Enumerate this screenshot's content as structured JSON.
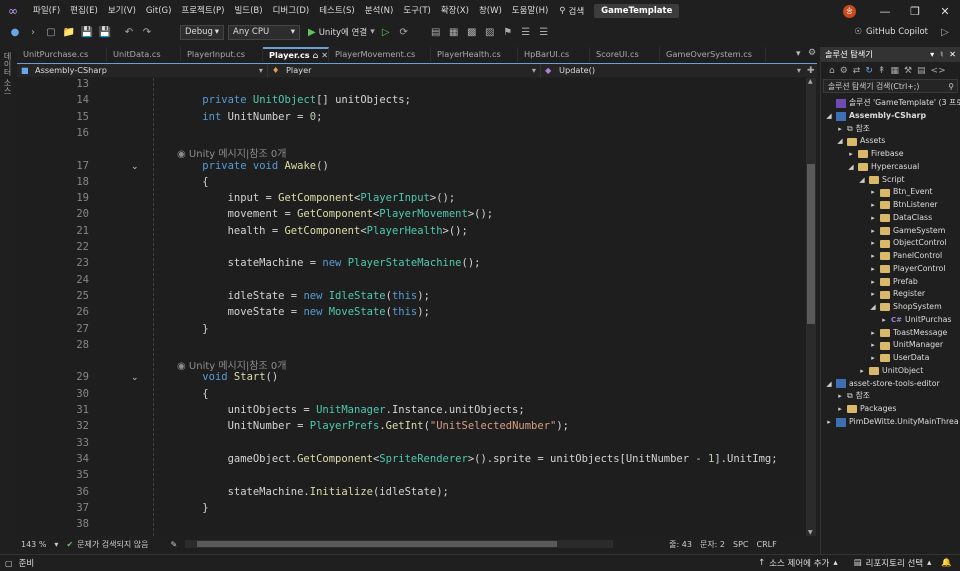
{
  "titlebar": {
    "menus": [
      "파일(F)",
      "편집(E)",
      "보기(V)",
      "Git(G)",
      "프로젝트(P)",
      "빌드(B)",
      "디버그(D)",
      "테스트(S)",
      "분석(N)",
      "도구(T)",
      "확장(X)",
      "창(W)",
      "도움말(H)"
    ],
    "search_label": "검색",
    "project_title": "GameTemplate",
    "avatar": "송",
    "github_copilot": "GitHub Copilot"
  },
  "toolbar": {
    "configuration": "Debug",
    "platform": "Any CPU",
    "run_label": "Unity에 연결"
  },
  "left_strip": {
    "label": "데이터 소스"
  },
  "tabs": [
    "UnitPurchase.cs",
    "UnitData.cs",
    "PlayerInput.cs",
    "Player.cs",
    "PlayerMovement.cs",
    "PlayerHealth.cs",
    "HpBarUI.cs",
    "ScoreUI.cs",
    "GameOverSystem.cs"
  ],
  "active_tab": "Player.cs",
  "navbar": {
    "project": "Assembly-CSharp",
    "class": "Player",
    "member": "Update()"
  },
  "editor": {
    "lines": [
      {
        "n": "13",
        "t": ""
      },
      {
        "n": "14",
        "t": "    private UnitObject[] unitObjects;"
      },
      {
        "n": "15",
        "t": "    int UnitNumber = 0;"
      },
      {
        "n": "16",
        "t": ""
      },
      {
        "hint": "Unity 메시지|참조 0개"
      },
      {
        "n": "17",
        "t": "    private void Awake()",
        "fold": true
      },
      {
        "n": "18",
        "t": "    {"
      },
      {
        "n": "19",
        "t": "        input = GetComponent<PlayerInput>();"
      },
      {
        "n": "20",
        "t": "        movement = GetComponent<PlayerMovement>();"
      },
      {
        "n": "21",
        "t": "        health = GetComponent<PlayerHealth>();"
      },
      {
        "n": "22",
        "t": ""
      },
      {
        "n": "23",
        "t": "        stateMachine = new PlayerStateMachine();"
      },
      {
        "n": "24",
        "t": ""
      },
      {
        "n": "25",
        "t": "        idleState = new IdleState(this);"
      },
      {
        "n": "26",
        "t": "        moveState = new MoveState(this);"
      },
      {
        "n": "27",
        "t": "    }"
      },
      {
        "n": "28",
        "t": ""
      },
      {
        "hint": "Unity 메시지|참조 0개"
      },
      {
        "n": "29",
        "t": "    void Start()",
        "fold": true
      },
      {
        "n": "30",
        "t": "    {"
      },
      {
        "n": "31",
        "t": "        unitObjects = UnitManager.Instance.unitObjects;"
      },
      {
        "n": "32",
        "t": "        UnitNumber = PlayerPrefs.GetInt(\"UnitSelectedNumber\");"
      },
      {
        "n": "33",
        "t": ""
      },
      {
        "n": "34",
        "t": "        gameObject.GetComponent<SpriteRenderer>().sprite = unitObjects[UnitNumber - 1].UnitImg;"
      },
      {
        "n": "35",
        "t": ""
      },
      {
        "n": "36",
        "t": "        stateMachine.Initialize(idleState);"
      },
      {
        "n": "37",
        "t": "    }"
      },
      {
        "n": "38",
        "t": ""
      },
      {
        "hint": "Unity 메시지|참조 0개"
      }
    ]
  },
  "editor_status": {
    "zoom": "143 %",
    "issues": "문제가 검색되지 않음",
    "line": "줄: 43",
    "char": "문자: 2",
    "spc": "SPC",
    "crlf": "CRLF"
  },
  "solution": {
    "title": "솔루션 탐색기",
    "search_placeholder": "솔루션 탐색기 검색(Ctrl+;)",
    "items": [
      {
        "label": "솔루션 'GameTemplate' (3 프로",
        "depth": 0,
        "icon": "sol",
        "arrow": ""
      },
      {
        "label": "Assembly-CSharp",
        "depth": 0,
        "icon": "proj",
        "arrow": "open",
        "bold": true
      },
      {
        "label": "참조",
        "depth": 1,
        "icon": "ref",
        "arrow": "closed"
      },
      {
        "label": "Assets",
        "depth": 1,
        "icon": "folder",
        "arrow": "open"
      },
      {
        "label": "Firebase",
        "depth": 2,
        "icon": "folder",
        "arrow": "closed"
      },
      {
        "label": "Hypercasual",
        "depth": 2,
        "icon": "folder",
        "arrow": "open"
      },
      {
        "label": "Script",
        "depth": 3,
        "icon": "folder",
        "arrow": "open"
      },
      {
        "label": "Btn_Event",
        "depth": 4,
        "icon": "folder",
        "arrow": "closed"
      },
      {
        "label": "BtnListener",
        "depth": 4,
        "icon": "folder",
        "arrow": "closed"
      },
      {
        "label": "DataClass",
        "depth": 4,
        "icon": "folder",
        "arrow": "closed"
      },
      {
        "label": "GameSystem",
        "depth": 4,
        "icon": "folder",
        "arrow": "closed"
      },
      {
        "label": "ObjectControl",
        "depth": 4,
        "icon": "folder",
        "arrow": "closed"
      },
      {
        "label": "PanelControl",
        "depth": 4,
        "icon": "folder",
        "arrow": "closed"
      },
      {
        "label": "PlayerControl",
        "depth": 4,
        "icon": "folder",
        "arrow": "closed"
      },
      {
        "label": "Prefab",
        "depth": 4,
        "icon": "folder",
        "arrow": "closed"
      },
      {
        "label": "Register",
        "depth": 4,
        "icon": "folder",
        "arrow": "closed"
      },
      {
        "label": "ShopSystem",
        "depth": 4,
        "icon": "folder",
        "arrow": "open"
      },
      {
        "label": "UnitPurchas",
        "depth": 5,
        "icon": "cs",
        "arrow": "closed"
      },
      {
        "label": "ToastMessage",
        "depth": 4,
        "icon": "folder",
        "arrow": "closed"
      },
      {
        "label": "UnitManager",
        "depth": 4,
        "icon": "folder",
        "arrow": "closed"
      },
      {
        "label": "UserData",
        "depth": 4,
        "icon": "folder",
        "arrow": "closed"
      },
      {
        "label": "UnitObject",
        "depth": 3,
        "icon": "folder",
        "arrow": "closed"
      },
      {
        "label": "asset-store-tools-editor",
        "depth": 0,
        "icon": "proj",
        "arrow": "open"
      },
      {
        "label": "참조",
        "depth": 1,
        "icon": "ref",
        "arrow": "closed"
      },
      {
        "label": "Packages",
        "depth": 1,
        "icon": "folder",
        "arrow": "closed"
      },
      {
        "label": "PimDeWitte.UnityMainThrea",
        "depth": 0,
        "icon": "proj",
        "arrow": "closed"
      }
    ]
  },
  "statusbar": {
    "ready": "준비",
    "source_control": "소스 제어에 추가",
    "repo": "리포지토리 선택"
  }
}
